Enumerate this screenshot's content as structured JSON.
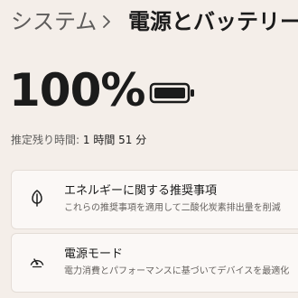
{
  "breadcrumb": {
    "parent": "システム",
    "current": "電源とバッテリー"
  },
  "battery": {
    "percent_text": "100%",
    "remaining_label": "推定残り時間:",
    "remaining_value": "1 時間 51 分"
  },
  "cards": [
    {
      "icon": "leaf-icon",
      "title": "エネルギーに関する推奨事項",
      "description": "これらの推奨事項を適用して二酸化炭素排出量を削減"
    },
    {
      "icon": "power-mode-icon",
      "title": "電源モード",
      "description": "電力消費とパフォーマンスに基づいてデバイスを最適化"
    }
  ],
  "colors": {
    "background": "#f4eee9",
    "card_background": "#fbf8f6",
    "primary_text": "#1b1b1b",
    "secondary_text": "#5e5c5b"
  }
}
